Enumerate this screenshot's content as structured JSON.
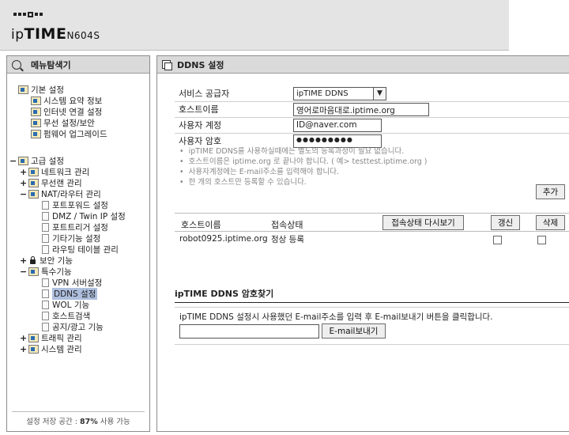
{
  "brand": {
    "ip": "ip",
    "time": "TIME",
    "model": "N604S"
  },
  "sidebar": {
    "title": "메뉴탐색기",
    "footer_prefix": "설정 저장 공간 : ",
    "footer_value": "87%",
    "footer_suffix": " 사용 가능",
    "basic": {
      "label": "기본 설정",
      "items": [
        "시스템 요약 정보",
        "인터넷 연결 설정",
        "무선 설정/보안",
        "펌웨어 업그레이드"
      ]
    },
    "advanced": {
      "label": "고급 설정",
      "network": "네트워크 관리",
      "wireless": "무선랜 관리",
      "nat": "NAT/라우터 관리",
      "nat_items": [
        "포트포워드 설정",
        "DMZ / Twin IP 설정",
        "포트트리거 설정",
        "기타기능 설정",
        "라우팅 테이블 관리"
      ],
      "security": "보안 기능",
      "special": "특수기능",
      "special_items": [
        "VPN 서버설정",
        "DDNS 설정",
        "WOL 기능",
        "호스트검색",
        "공지/광고 기능"
      ],
      "traffic": "트래픽 관리",
      "system": "시스템 관리"
    }
  },
  "main": {
    "title": "DDNS 설정",
    "form": {
      "provider_label": "서비스 공급자",
      "provider_value": "ipTIME DDNS",
      "hostname_label": "호스트이름",
      "hostname_value": "영어로마음대로.iptime.org",
      "account_label": "사용자 계정",
      "account_value": "ID@naver.com",
      "password_label": "사용자 암호",
      "password_value": "●●●●●●●●●"
    },
    "notes": [
      "ipTIME DDNS를 사용하실때에는 별도의 등록과정이 필요 없습니다.",
      "호스트이름은 iptime.org 로 끝나야 합니다. ( 예> testtest.iptime.org )",
      "사용자계정에는 E-mail주소를 입력해야 합니다.",
      "한 개의 호스트만 등록할 수 있습니다."
    ],
    "add_button": "추가",
    "table": {
      "col_host": "호스트이름",
      "col_status": "접속상태",
      "refresh_button": "접속상태 다시보기",
      "update_button": "갱신",
      "delete_button": "삭제",
      "rows": [
        {
          "host": "robot0925.iptime.org",
          "status": "정상 등록"
        }
      ]
    },
    "find_password": {
      "title": "ipTIME DDNS 암호찾기",
      "description": "ipTIME DDNS 설정시 사용했던 E-mail주소를 입력 후 E-mail보내기 버튼을 클릭합니다.",
      "send_button": "E-mail보내기",
      "email_value": ""
    }
  },
  "colors": {
    "header_bg": "#e4e4e4",
    "panel_head_bg": "#dadada",
    "selected_bg": "#aebfde"
  }
}
